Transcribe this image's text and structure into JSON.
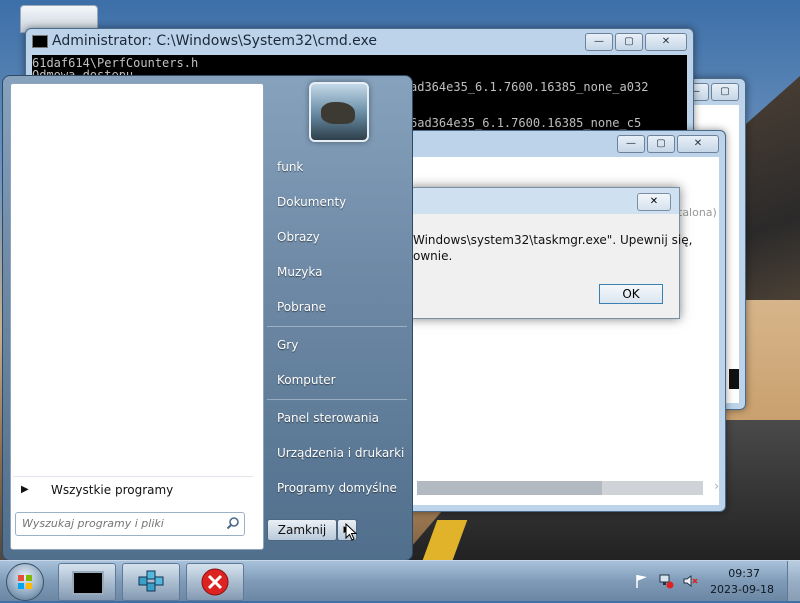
{
  "cmd_window": {
    "title": "Administrator: C:\\Windows\\System32\\cmd.exe",
    "lines": [
      "61daf614\\PerfCounters.h",
      "Odmowa dostępu",
      "ad364e35_6.1.7600.16385_none_a032",
      "6ad364e35_6.1.7600.16385_none_c5"
    ],
    "controls": {
      "minimize": "—",
      "maximize": "▢",
      "close": "✕"
    }
  },
  "error_dialog": {
    "message": "Windows\\system32\\taskmgr.exe\". Upewnij się,\nownie.",
    "ok_label": "OK",
    "side_fragment": "talona)"
  },
  "start_menu": {
    "user_items": [
      "funk",
      "Dokumenty",
      "Obrazy",
      "Muzyka",
      "Pobrane"
    ],
    "system_items": [
      "Gry",
      "Komputer"
    ],
    "settings_items": [
      "Panel sterowania",
      "Urządzenia i drukarki",
      "Programy domyślne"
    ],
    "all_programs": "Wszystkie programy",
    "search_placeholder": "Wyszukaj programy i pliki",
    "shutdown_label": "Zamknij"
  },
  "taskbar": {
    "time": "09:37",
    "date": "2023-09-18",
    "buttons": [
      "cmd-task",
      "registry-task",
      "error-task"
    ]
  }
}
